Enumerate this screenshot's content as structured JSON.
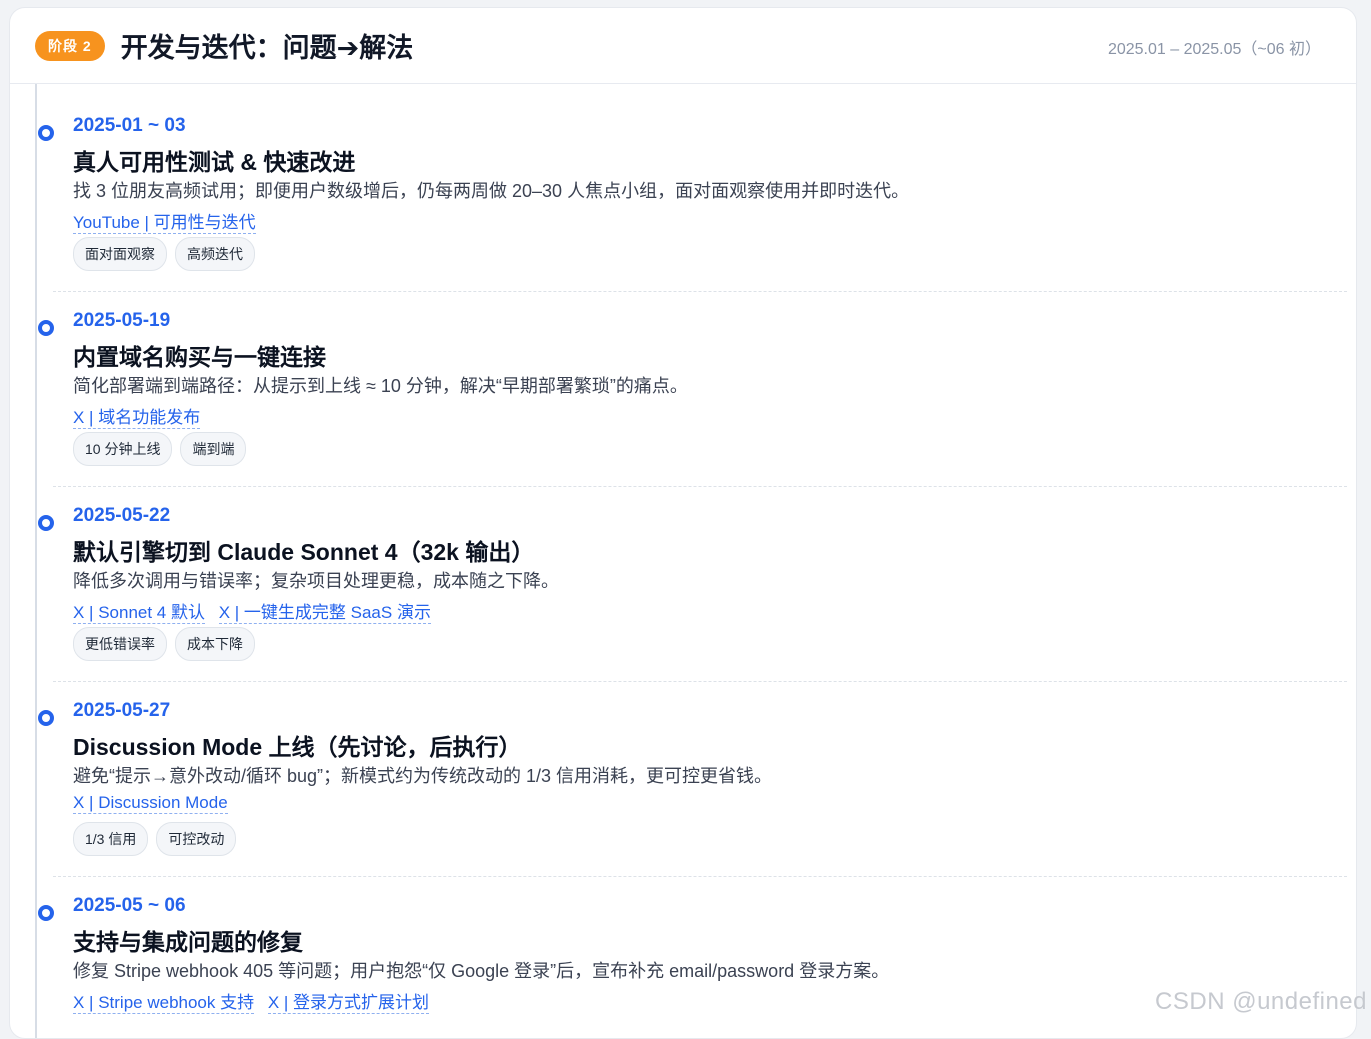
{
  "stage": {
    "badge": "阶段 2",
    "title": "开发与迭代：问题➔解法",
    "range": "2025.01 – 2025.05（~06 初）"
  },
  "entries": [
    {
      "date": "2025-01 ~ 03",
      "title": "真人可用性测试 & 快速改进",
      "desc": "找 3 位朋友高频试用；即便用户数级增后，仍每两周做 20–30 人焦点小组，面对面观察使用并即时迭代。",
      "links": [
        "YouTube | 可用性与迭代"
      ],
      "tags": [
        "面对面观察",
        "高频迭代"
      ]
    },
    {
      "date": "2025-05-19",
      "title": "内置域名购买与一键连接",
      "desc": "简化部署端到端路径：从提示到上线 ≈ 10 分钟，解决“早期部署繁琐”的痛点。",
      "links": [
        "X | 域名功能发布"
      ],
      "tags": [
        "10 分钟上线",
        "端到端"
      ]
    },
    {
      "date": "2025-05-22",
      "title": "默认引擎切到 Claude Sonnet 4（32k 输出）",
      "desc": "降低多次调用与错误率；复杂项目处理更稳，成本随之下降。",
      "links": [
        "X | Sonnet 4 默认",
        "X | 一键生成完整 SaaS 演示"
      ],
      "tags": [
        "更低错误率",
        "成本下降"
      ]
    },
    {
      "date": "2025-05-27",
      "title": "Discussion Mode 上线（先讨论，后执行）",
      "desc": "避免“提示→意外改动/循环 bug”；新模式约为传统改动的 1/3 信用消耗，更可控更省钱。",
      "links": [
        "X | Discussion Mode"
      ],
      "tags": [
        "1/3 信用",
        "可控改动"
      ]
    },
    {
      "date": "2025-05 ~ 06",
      "title": "支持与集成问题的修复",
      "desc": "修复 Stripe webhook 405 等问题；用户抱怨“仅 Google 登录”后，宣布补充 email/password 登录方案。",
      "links": [
        "X | Stripe webhook 支持",
        "X | 登录方式扩展计划"
      ],
      "tags": []
    }
  ],
  "watermark": "CSDN @undefined",
  "colors": {
    "accent": "#2563eb",
    "badge": "#f7931e"
  }
}
